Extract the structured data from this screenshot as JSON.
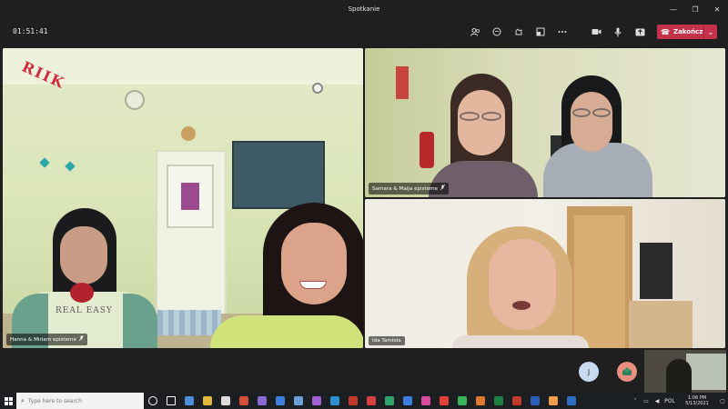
{
  "window": {
    "title": "Spotkanie"
  },
  "window_buttons": [
    "—",
    "❐",
    "✕"
  ],
  "meeting": {
    "timer": "01:51:41",
    "toolbar_icons": [
      "people-icon",
      "chat-icon",
      "reactions-icon",
      "rooms-icon",
      "more-icon",
      "camera-icon",
      "mic-icon",
      "share-icon"
    ],
    "leave_label": "Zakończ",
    "leave_color": "#c4314b"
  },
  "participants": [
    {
      "name": "Hanna & Miriam episteme",
      "muted": true
    },
    {
      "name": "Samara & Maija episteme",
      "muted": true
    },
    {
      "name": "Ida Tamiola",
      "muted": false
    }
  ],
  "scene_text": {
    "wall_letters": "RIIK",
    "shirt_text": "REAL  EASY"
  },
  "avatars": [
    {
      "initial": "J",
      "color": "#c9d9f0"
    },
    {
      "initial": "",
      "color": "#e88f80"
    }
  ],
  "taskbar": {
    "search_placeholder": "Type here to search",
    "app_colors": [
      "#ffffff",
      "#ffffff",
      "#4a8fd8",
      "#e0b93a",
      "#dddddd",
      "#d64b3a",
      "#8a6ad1",
      "#3f7fe0",
      "#6aa0d8",
      "#a160d6",
      "#2d8fd0",
      "#c0392b",
      "#d63f3f",
      "#30a46c",
      "#3b7ddd",
      "#d94da0",
      "#e6403a",
      "#3bb35b",
      "#e0762f",
      "#1e7f45",
      "#c0392b",
      "#2b5fb8",
      "#f39c4a",
      "#2d6cc4"
    ],
    "language": "POL",
    "time": "1:06 PM",
    "date": "5/13/2021"
  }
}
